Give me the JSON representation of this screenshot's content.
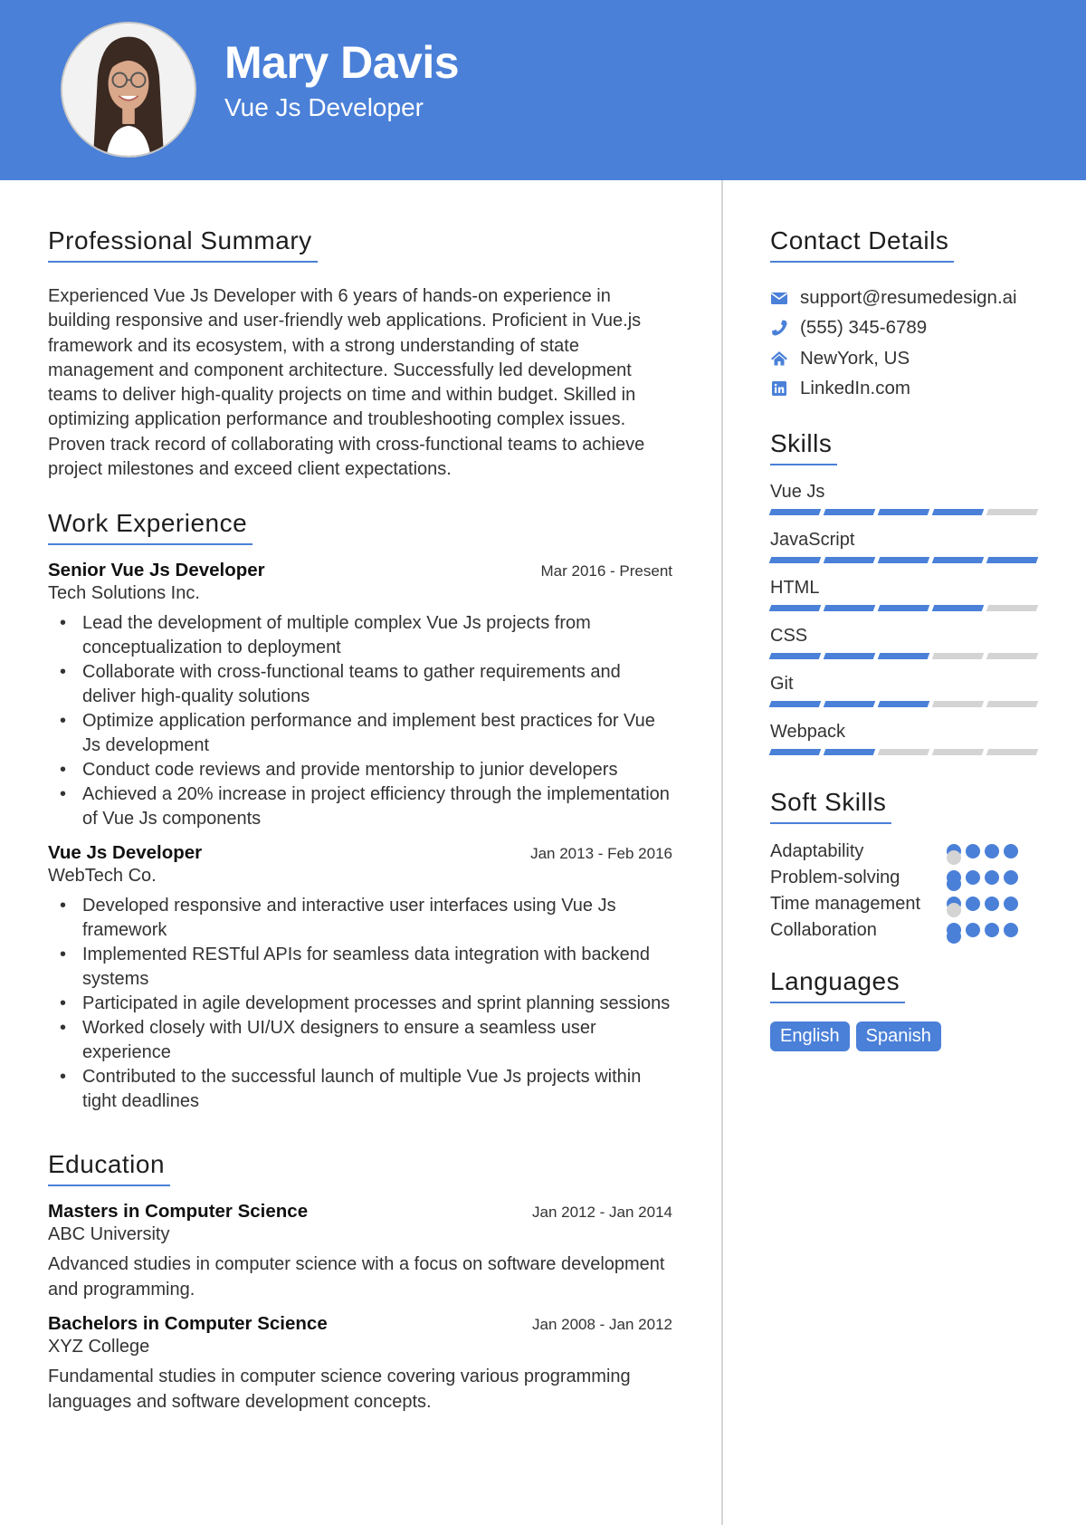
{
  "header": {
    "name": "Mary Davis",
    "title": "Vue Js Developer",
    "accent_color": "#4a80d8"
  },
  "summary": {
    "heading": "Professional Summary",
    "text": "Experienced Vue Js Developer with 6 years of hands-on experience in building responsive and user-friendly web applications. Proficient in Vue.js framework and its ecosystem, with a strong understanding of state management and component architecture. Successfully led development teams to deliver high-quality projects on time and within budget. Skilled in optimizing application performance and troubleshooting complex issues. Proven track record of collaborating with cross-functional teams to achieve project milestones and exceed client expectations."
  },
  "experience": {
    "heading": "Work Experience",
    "jobs": [
      {
        "title": "Senior Vue Js Developer",
        "dates": "Mar 2016 - Present",
        "company": "Tech Solutions Inc.",
        "bullets": [
          "Lead the development of multiple complex Vue Js projects from conceptualization to deployment",
          "Collaborate with cross-functional teams to gather requirements and deliver high-quality solutions",
          "Optimize application performance and implement best practices for Vue Js development",
          "Conduct code reviews and provide mentorship to junior developers",
          "Achieved a 20% increase in project efficiency through the implementation of Vue Js components"
        ]
      },
      {
        "title": "Vue Js Developer",
        "dates": "Jan 2013 - Feb 2016",
        "company": "WebTech Co.",
        "bullets": [
          "Developed responsive and interactive user interfaces using Vue Js framework",
          "Implemented RESTful APIs for seamless data integration with backend systems",
          "Participated in agile development processes and sprint planning sessions",
          "Worked closely with UI/UX designers to ensure a seamless user experience",
          "Contributed to the successful launch of multiple Vue Js projects within tight deadlines"
        ]
      }
    ]
  },
  "education": {
    "heading": "Education",
    "items": [
      {
        "degree": "Masters in Computer Science",
        "dates": "Jan 2012 - Jan 2014",
        "school": "ABC University",
        "description": "Advanced studies in computer science with a focus on software development and programming."
      },
      {
        "degree": "Bachelors in Computer Science",
        "dates": "Jan 2008 - Jan 2012",
        "school": "XYZ College",
        "description": "Fundamental studies in computer science covering various programming languages and software development concepts."
      }
    ]
  },
  "contact": {
    "heading": "Contact Details",
    "items": [
      {
        "icon": "envelope-icon",
        "text": "support@resumedesign.ai"
      },
      {
        "icon": "phone-icon",
        "text": "(555) 345-6789"
      },
      {
        "icon": "home-icon",
        "text": "NewYork, US"
      },
      {
        "icon": "linkedin-icon",
        "text": "LinkedIn.com"
      }
    ]
  },
  "skills": {
    "heading": "Skills",
    "max": 5,
    "items": [
      {
        "name": "Vue Js",
        "level": 4
      },
      {
        "name": "JavaScript",
        "level": 5
      },
      {
        "name": "HTML",
        "level": 4
      },
      {
        "name": "CSS",
        "level": 3
      },
      {
        "name": "Git",
        "level": 3
      },
      {
        "name": "Webpack",
        "level": 2
      }
    ]
  },
  "soft_skills": {
    "heading": "Soft Skills",
    "max": 5,
    "items": [
      {
        "name": "Adaptability",
        "level": 4
      },
      {
        "name": "Problem-solving",
        "level": 5
      },
      {
        "name": "Time management",
        "level": 4
      },
      {
        "name": "Collaboration",
        "level": 5
      }
    ]
  },
  "languages": {
    "heading": "Languages",
    "items": [
      "English",
      "Spanish"
    ]
  }
}
